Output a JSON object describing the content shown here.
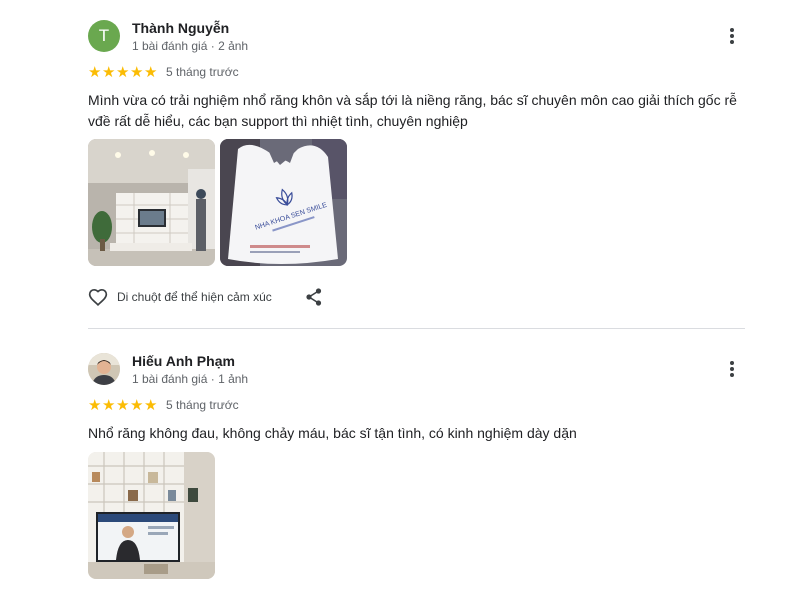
{
  "reviews": [
    {
      "avatar_letter": "T",
      "avatar_color": "#6aa84f",
      "name": "Thành Nguyễn",
      "meta": "1 bài đánh giá · 2 ảnh",
      "rating": 5,
      "date": "5 tháng trước",
      "text_line1": "Mình vừa có trải nghiệm nhổ răng khôn và sắp tới là niềng răng, bác sĩ chuyên môn cao giải thích gốc rễ",
      "text_line2": "vđề rất dễ hiểu, các bạn support thì nhiệt tình, chuyên nghiệp",
      "photos": [
        {
          "subject": "clinic-interior"
        },
        {
          "subject": "clinic-bag",
          "brand_text": "NHA KHOA SEN SMILE"
        }
      ],
      "reaction_label": "Di chuột để thể hiện cảm xúc"
    },
    {
      "name": "Hiếu Anh Phạm",
      "meta": "1 bài đánh giá · 1 ảnh",
      "rating": 5,
      "date": "5 tháng trước",
      "text_line1": "Nhổ răng không đau, không chảy máu, bác sĩ tận tình, có kinh nghiệm dày dặn",
      "photos": [
        {
          "subject": "clinic-shelves-tv"
        }
      ]
    }
  ],
  "colors": {
    "star": "#fbbc04",
    "divider": "#dadce0",
    "secondary_text": "#5f6368"
  },
  "icons": [
    "more-vert-icon",
    "heart-outline-icon",
    "share-icon",
    "star-icon"
  ]
}
